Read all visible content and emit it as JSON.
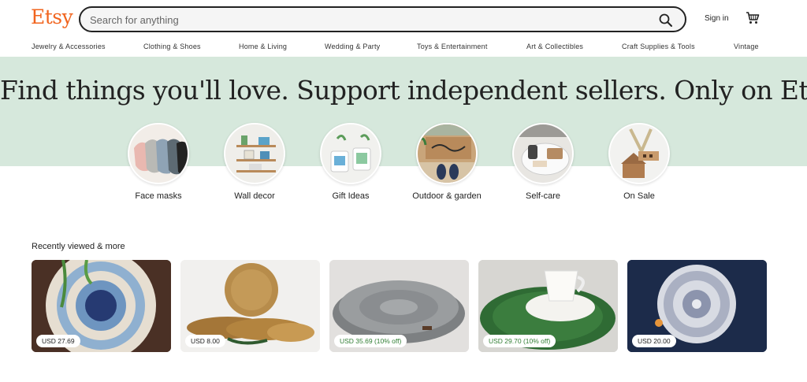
{
  "header": {
    "logo": "Etsy",
    "search_placeholder": "Search for anything",
    "signin_label": "Sign in"
  },
  "nav": [
    "Jewelry & Accessories",
    "Clothing & Shoes",
    "Home & Living",
    "Wedding & Party",
    "Toys & Entertainment",
    "Art & Collectibles",
    "Craft Supplies & Tools",
    "Vintage"
  ],
  "hero": {
    "title": "Find things you'll love. Support independent sellers. Only on Etsy."
  },
  "categories": [
    {
      "label": "Face masks"
    },
    {
      "label": "Wall decor"
    },
    {
      "label": "Gift Ideas"
    },
    {
      "label": "Outdoor & garden"
    },
    {
      "label": "Self-care"
    },
    {
      "label": "On Sale"
    }
  ],
  "recent": {
    "title": "Recently viewed & more",
    "items": [
      {
        "price": "USD 27.69"
      },
      {
        "price": "USD 8.00"
      },
      {
        "price": "USD 35.69 (10% off)"
      },
      {
        "price": "USD 29.70 (10% off)"
      },
      {
        "price": "USD 20.00"
      }
    ]
  },
  "colors": {
    "brand": "#f1641e",
    "hero_bg": "#d6e8dc",
    "sale_text": "#2f7d32"
  },
  "icons": [
    "search-icon",
    "cart-icon"
  ]
}
